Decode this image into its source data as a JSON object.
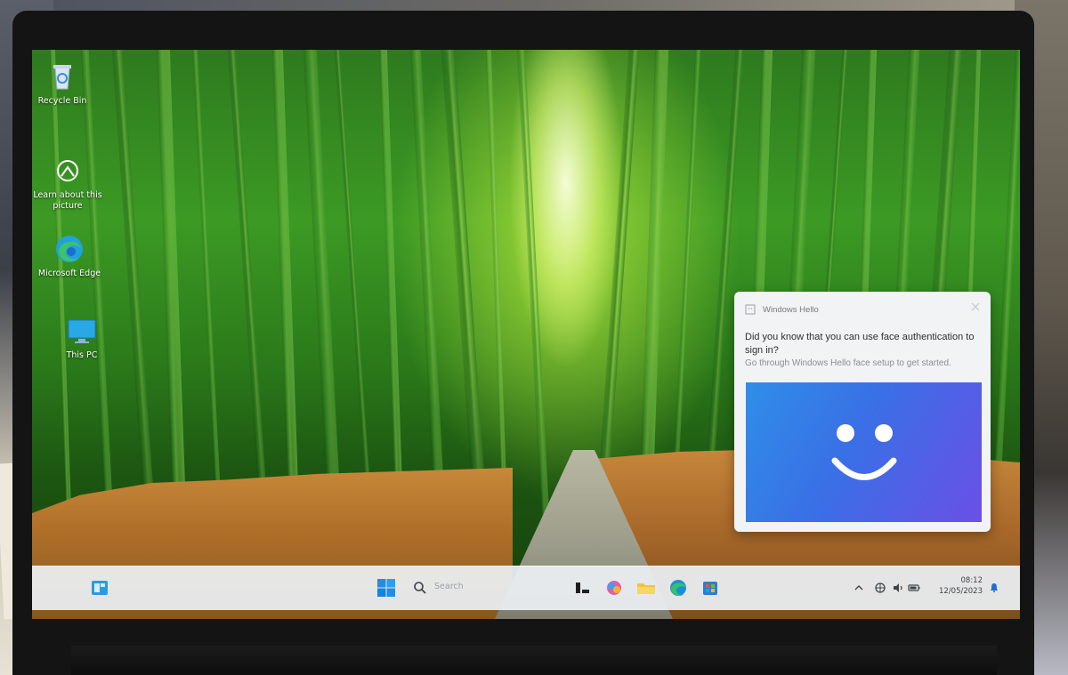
{
  "desktop": {
    "icons": [
      {
        "label": "Recycle Bin",
        "icon": "recycle-bin-icon"
      },
      {
        "label": "Learn about this picture",
        "icon": "learn-about-picture-icon"
      },
      {
        "label": "Microsoft Edge",
        "icon": "edge-icon"
      },
      {
        "label": "This PC",
        "icon": "this-pc-icon"
      }
    ]
  },
  "notification": {
    "app_name": "Windows Hello",
    "title": "Did you know that you can use face authentication to sign in?",
    "body": "Go through Windows Hello face setup to get started.",
    "hero_icon": "smiley-face-icon",
    "hero_color_start": "#2f8ee8",
    "hero_color_end": "#6b4fe6"
  },
  "taskbar": {
    "search_placeholder": "Search",
    "pinned": [
      "widgets-icon",
      "start-icon",
      "search-icon",
      "task-view-icon",
      "copilot-icon",
      "file-explorer-icon",
      "edge-icon",
      "store-icon"
    ],
    "tray": [
      "chevron-up-icon",
      "network-icon",
      "volume-icon",
      "battery-icon",
      "notification-bell-icon"
    ],
    "time": "08:12",
    "date": "12/05/2023"
  },
  "colors": {
    "accent": "#0078d4",
    "taskbar_bg": "#ecf0f4"
  }
}
